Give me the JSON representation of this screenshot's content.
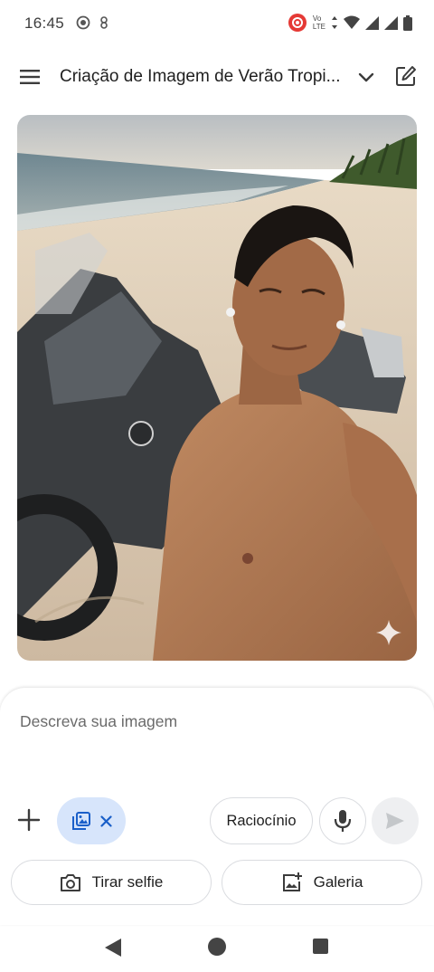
{
  "status_bar": {
    "time": "16:45",
    "icons": [
      "location-target-icon",
      "fan-icon",
      "screen-record-icon",
      "volte-icon",
      "data-arrows-icon",
      "wifi-icon",
      "signal-icon",
      "signal-icon",
      "battery-icon"
    ],
    "volte_line1": "Vo",
    "volte_line2": "LTE"
  },
  "header": {
    "title": "Criação de Imagem de Verão Tropi...",
    "menu_icon": "menu-icon",
    "chevron_icon": "chevron-down-icon",
    "new_chat_icon": "edit-icon"
  },
  "image": {
    "subject": "generated-photo",
    "badge_icon": "sparkle-icon"
  },
  "composer": {
    "placeholder": "Descreva sua imagem",
    "attach_chip_icons": [
      "image-edit-icon",
      "close-icon"
    ],
    "reasoning_label": "Raciocínio",
    "mic_icon": "mic-icon",
    "send_icon": "send-icon",
    "selfie_label": "Tirar selfie",
    "selfie_icon": "camera-icon",
    "gallery_label": "Galeria",
    "gallery_icon": "add-photo-icon"
  },
  "colors": {
    "accent": "#1a73e8",
    "chip_bg": "#d7e5fb",
    "border": "#dadce0",
    "record": "#e53935"
  },
  "nav": {
    "icons": [
      "back-icon",
      "home-icon",
      "recents-icon"
    ]
  }
}
